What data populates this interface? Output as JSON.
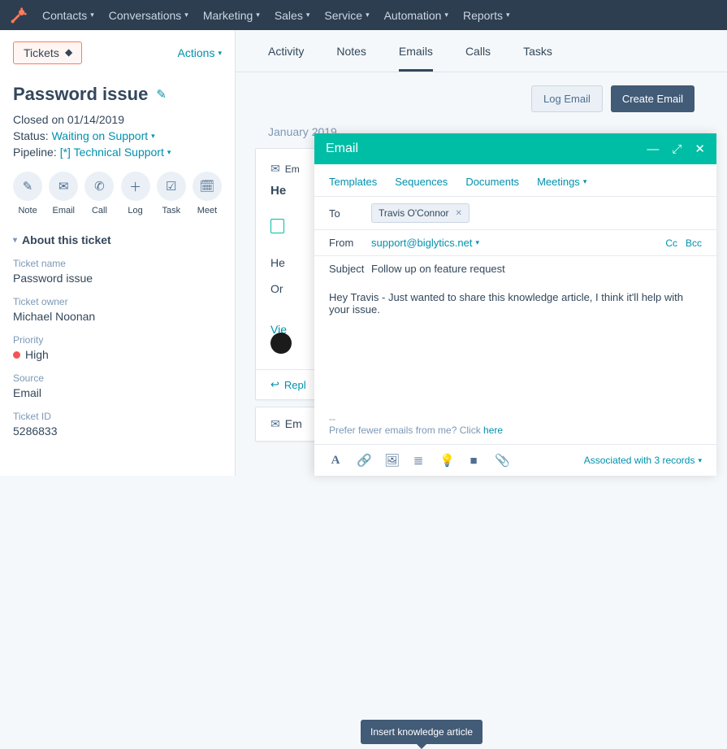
{
  "nav": {
    "items": [
      "Contacts",
      "Conversations",
      "Marketing",
      "Sales",
      "Service",
      "Automation",
      "Reports"
    ]
  },
  "breadcrumb": {
    "tickets_label": "Tickets",
    "actions_label": "Actions"
  },
  "record": {
    "title": "Password issue",
    "closed_text": "Closed on 01/14/2019",
    "status_label": "Status:",
    "status_value": "Waiting on Support",
    "pipeline_label": "Pipeline:",
    "pipeline_value": "[*] Technical Support"
  },
  "quick_actions": [
    {
      "icon": "✎",
      "label": "Note"
    },
    {
      "icon": "✉",
      "label": "Email"
    },
    {
      "icon": "✆",
      "label": "Call"
    },
    {
      "icon": "＋",
      "label": "Log"
    },
    {
      "icon": "☑",
      "label": "Task"
    },
    {
      "icon": "🗓",
      "label": "Meet"
    }
  ],
  "about": {
    "header": "About this ticket",
    "fields": {
      "ticket_name_label": "Ticket name",
      "ticket_name_value": "Password issue",
      "owner_label": "Ticket owner",
      "owner_value": "Michael Noonan",
      "priority_label": "Priority",
      "priority_value": "High",
      "source_label": "Source",
      "source_value": "Email",
      "id_label": "Ticket ID",
      "id_value": "5286833"
    }
  },
  "tabs": {
    "items": [
      "Activity",
      "Notes",
      "Emails",
      "Calls",
      "Tasks"
    ],
    "log_email": "Log Email",
    "create_email": "Create Email"
  },
  "timeline": {
    "month_label": "January 2019",
    "email_prefix": "Em",
    "subject_prefix": "He",
    "body_prefix_1": "He",
    "body_prefix_2": "Or",
    "view_prefix": "Vie",
    "reply_prefix": "Repl",
    "em2_prefix": "Em"
  },
  "email_panel": {
    "title": "Email",
    "tabs": {
      "templates": "Templates",
      "sequences": "Sequences",
      "documents": "Documents",
      "meetings": "Meetings"
    },
    "to_label": "To",
    "to_chip": "Travis O'Connor",
    "from_label": "From",
    "from_value": "support@biglytics.net",
    "cc_label": "Cc",
    "bcc_label": "Bcc",
    "subject_label": "Subject",
    "subject_value": "Follow up on feature request",
    "body": "Hey Travis - Just wanted to share this knowledge article, I think it'll help with your issue.",
    "sig_dash": "--",
    "sig_text": "Prefer fewer emails from me? Click ",
    "sig_link": "here",
    "tooltip": "Insert knowledge article",
    "toolbar_items": [
      "A",
      "link",
      "image",
      "align",
      "bulb",
      "video",
      "attach"
    ],
    "associated_text": "Associated with 3 records"
  }
}
